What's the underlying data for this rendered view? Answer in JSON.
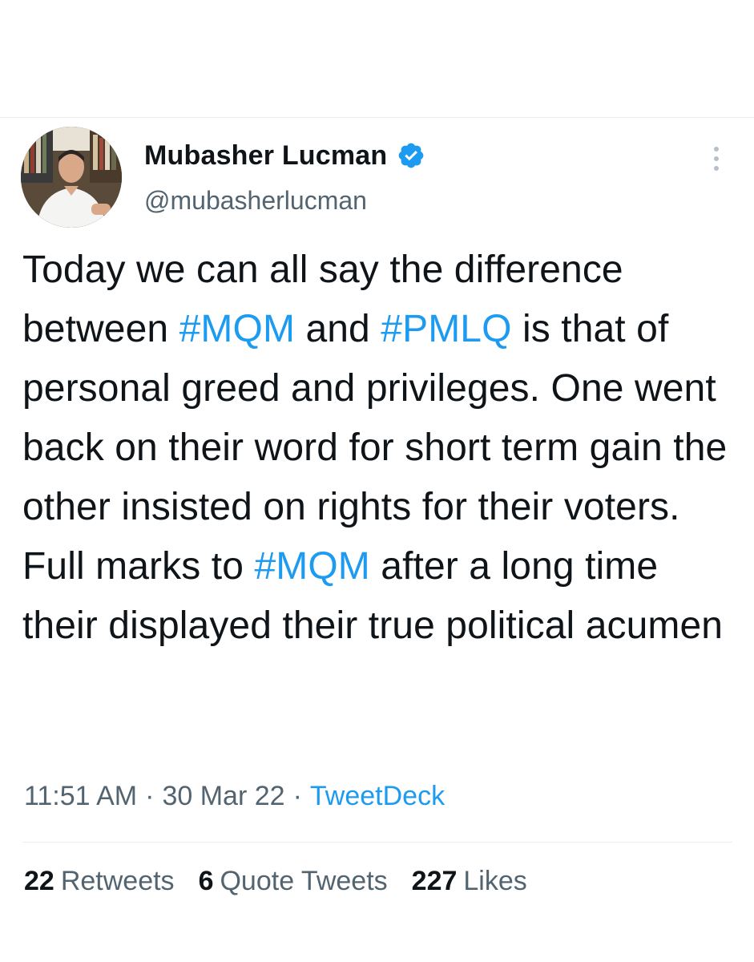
{
  "author": {
    "display_name": "Mubasher Lucman",
    "handle": "@mubasherlucman",
    "verified": true,
    "avatar_icon": "profile-photo"
  },
  "tweet": {
    "segments": [
      {
        "text": "Today we can all say the difference between ",
        "type": "text"
      },
      {
        "text": "#MQM",
        "type": "hashtag"
      },
      {
        "text": " and ",
        "type": "text"
      },
      {
        "text": "#PMLQ",
        "type": "hashtag"
      },
      {
        "text": " is that of personal greed and privileges. One went back on their word for short term gain the other insisted on rights for their voters. Full marks to  ",
        "type": "text"
      },
      {
        "text": "#MQM",
        "type": "hashtag"
      },
      {
        "text": " after a long time their displayed their true political acumen",
        "type": "text"
      }
    ]
  },
  "meta": {
    "time": "11:51 AM",
    "separator": "·",
    "date": "30 Mar 22",
    "source": "TweetDeck"
  },
  "stats": {
    "retweets_count": "22",
    "retweets_label": "Retweets",
    "quotes_count": "6",
    "quotes_label": "Quote Tweets",
    "likes_count": "227",
    "likes_label": "Likes"
  },
  "colors": {
    "link": "#1d9bf0",
    "secondary_text": "#536471",
    "primary_text": "#0f1419",
    "divider": "#eceef0"
  },
  "icons": {
    "verified": "verified-badge-icon",
    "more": "more-vertical-icon"
  }
}
